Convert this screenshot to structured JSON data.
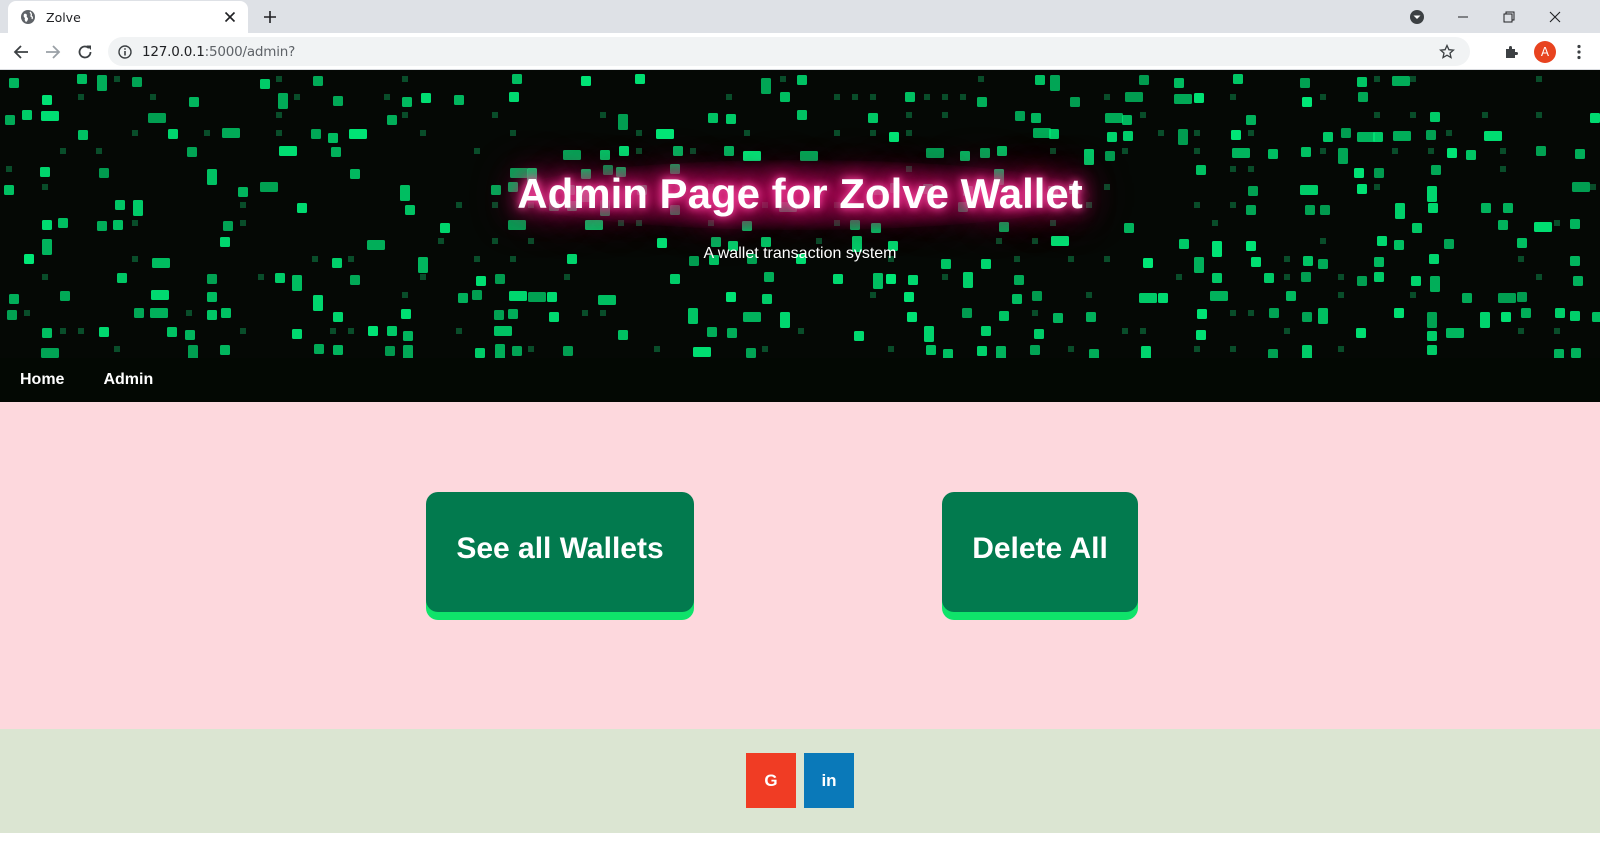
{
  "browser": {
    "tab_title": "Zolve",
    "url_host": "127.0.0.1",
    "url_path": ":5000/admin?",
    "profile_initial": "A"
  },
  "hero": {
    "title": "Admin Page for Zolve Wallet",
    "subtitle": "A wallet transaction system"
  },
  "nav": {
    "items": [
      {
        "label": "Home"
      },
      {
        "label": "Admin"
      }
    ]
  },
  "actions": {
    "see_all_wallets": "See all Wallets",
    "delete_all": "Delete All"
  },
  "footer": {
    "google_label": "G",
    "linkedin_label": "in"
  },
  "colors": {
    "hero_bg": "#050805",
    "matrix_green": "#00e676",
    "main_bg": "#fdd8dd",
    "button_bg": "#027a4e",
    "button_shadow": "#0fe36a",
    "footer_bg": "#dbe5d2",
    "google": "#f03c24",
    "linkedin": "#0a79b9"
  },
  "icons": {
    "tab_favicon": "globe-icon",
    "info": "info-icon",
    "bookmark": "star-icon",
    "extensions": "puzzle-icon"
  }
}
